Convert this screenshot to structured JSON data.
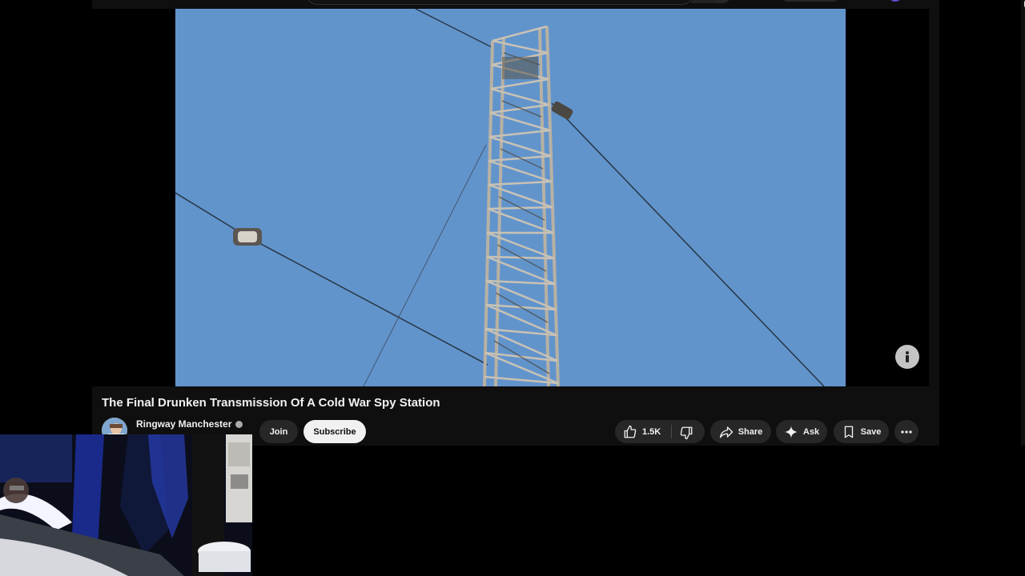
{
  "video": {
    "title": "The Final Drunken Transmission Of A Cold War Spy Station"
  },
  "channel": {
    "name": "Ringway Manchester",
    "verified": true
  },
  "actions": {
    "join_label": "Join",
    "subscribe_label": "Subscribe",
    "like_count": "1.5K",
    "share_label": "Share",
    "ask_label": "Ask",
    "save_label": "Save"
  },
  "icons": {
    "like": "thumbs-up-icon",
    "dislike": "thumbs-down-icon",
    "share": "share-arrow-icon",
    "ask": "sparkle-icon",
    "save": "bookmark-icon",
    "more": "more-horizontal-icon",
    "info": "info-icon"
  },
  "colors": {
    "page_background": "#0f0f0f",
    "pill_background": "#272727",
    "subscribe_background": "#f1f1f1",
    "text": "#f1f1f1",
    "sky": "#6294cc"
  }
}
